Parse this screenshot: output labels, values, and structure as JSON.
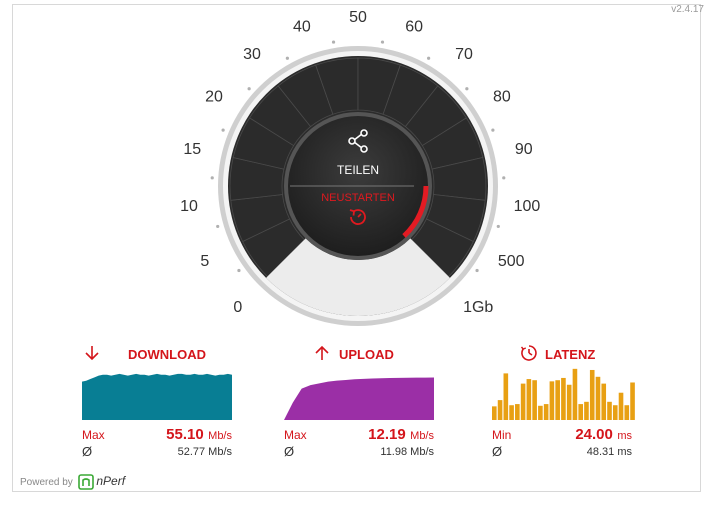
{
  "version": "v2.4.17",
  "gauge": {
    "scale": [
      "0",
      "5",
      "10",
      "15",
      "20",
      "30",
      "40",
      "50",
      "60",
      "70",
      "80",
      "90",
      "100",
      "500",
      "1Gb"
    ],
    "share_label": "TEILEN",
    "restart_label": "NEUSTARTEN",
    "share_icon": "share-icon",
    "restart_icon": "restart-icon"
  },
  "download": {
    "title": "DOWNLOAD",
    "icon": "arrow-down-icon",
    "color": "#087e94",
    "max_label": "Max",
    "max_value": "55.10",
    "max_unit": "Mb/s",
    "avg_symbol": "Ø",
    "avg_value": "52.77 Mb/s",
    "samples": [
      44,
      45,
      47,
      49,
      51,
      52,
      52,
      51,
      52,
      53,
      52,
      51,
      52,
      53,
      52,
      52,
      51,
      52,
      53,
      52,
      52,
      51,
      52,
      53,
      53,
      52,
      52,
      53,
      52,
      52,
      53,
      52,
      51,
      52,
      52,
      53,
      52
    ]
  },
  "upload": {
    "title": "UPLOAD",
    "icon": "arrow-up-icon",
    "color": "#9b2fa6",
    "max_label": "Max",
    "max_value": "12.19",
    "max_unit": "Mb/s",
    "avg_symbol": "Ø",
    "avg_value": "11.98 Mb/s",
    "samples": [
      0,
      5,
      9,
      10,
      10.5,
      11,
      11.3,
      11.5,
      11.7,
      11.8,
      11.9,
      12,
      12.05,
      12.1,
      12.12,
      12.15,
      12.17,
      12.19
    ]
  },
  "latency": {
    "title": "LATENZ",
    "icon": "stopwatch-icon",
    "color": "#e8a013",
    "min_label": "Min",
    "min_value": "24.00",
    "min_unit": "ms",
    "avg_symbol": "Ø",
    "avg_value": "48.31 ms",
    "samples": [
      24,
      35,
      82,
      26,
      28,
      64,
      72,
      70,
      25,
      28,
      68,
      70,
      74,
      62,
      90,
      28,
      32,
      88,
      76,
      64,
      32,
      26,
      48,
      26,
      66
    ]
  },
  "footer": {
    "powered_by": "Powered by",
    "brand": "nPerf"
  }
}
